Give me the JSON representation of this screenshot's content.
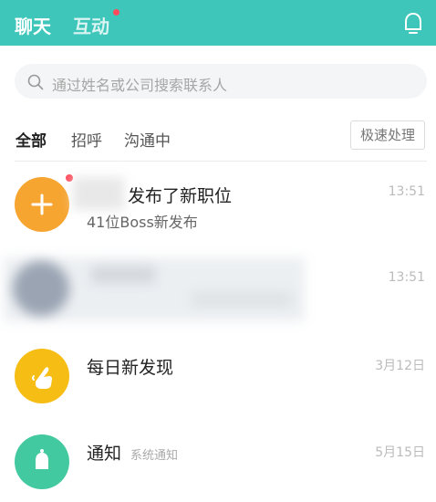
{
  "header": {
    "tab_chat": "聊天",
    "tab_interact": "互动",
    "bell_icon": "bell-icon",
    "color": "#3ec6bb"
  },
  "search": {
    "placeholder": "通过姓名或公司搜索联系人",
    "icon": "search-icon"
  },
  "filters": {
    "items": [
      "全部",
      "招呼",
      "沟通中"
    ],
    "quick_action": "极速处理"
  },
  "conversations": [
    {
      "title": "发布了新职位",
      "subtitle": "41位Boss新发布",
      "time": "13:51",
      "icon": "plus-icon"
    },
    {
      "time": "13:51"
    },
    {
      "title": "每日新发现",
      "time": "3月12日",
      "icon": "finger-heart-icon"
    },
    {
      "title": "通知",
      "tag": "系统通知",
      "time": "5月15日",
      "icon": "bell-icon"
    }
  ]
}
